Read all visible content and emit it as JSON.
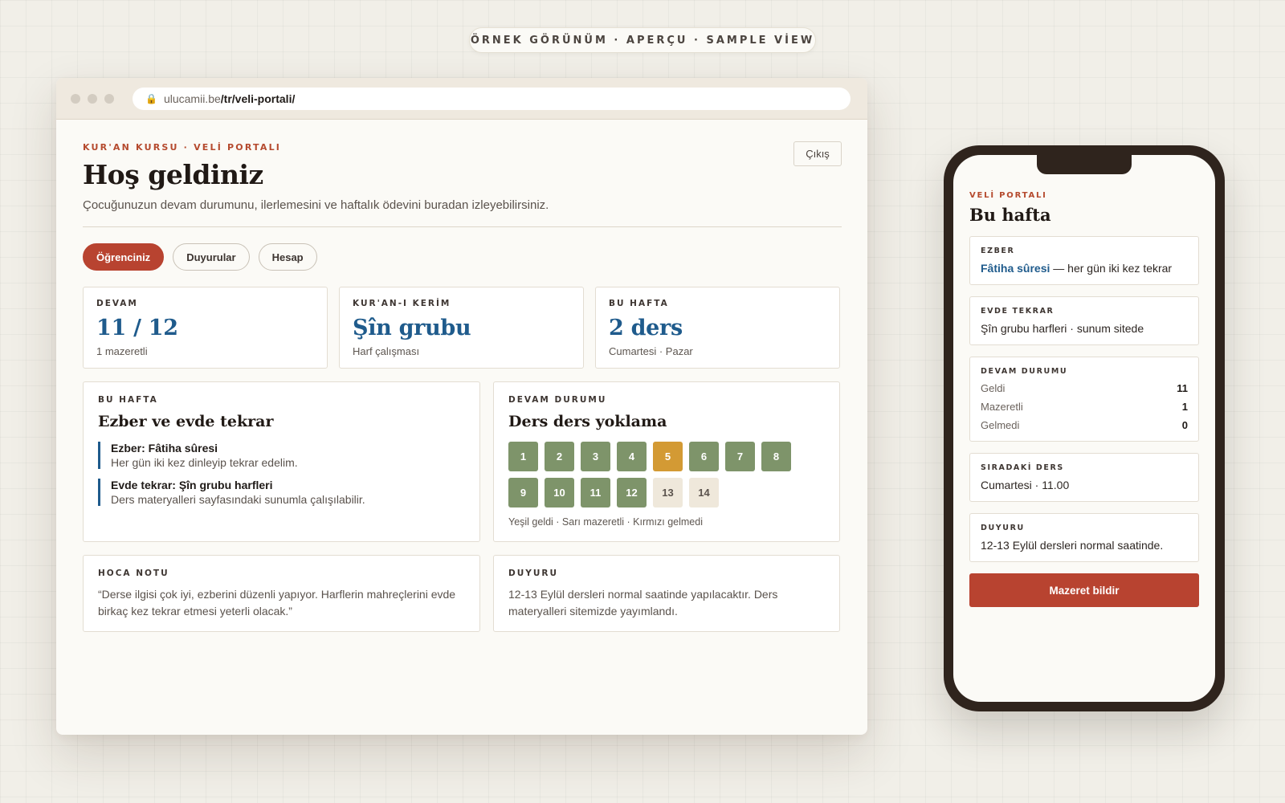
{
  "caption": "ÖRNEK GÖRÜNÜM · APERÇU · SAMPLE VİEW",
  "browser": {
    "url_domain": "ulucamii.be",
    "url_path": "/tr/veli-portali/"
  },
  "page": {
    "eyebrow": "KUR'AN KURSU · VELİ PORTALI",
    "logout": "Çıkış",
    "title": "Hoş geldiniz",
    "subtitle": "Çocuğunuzun devam durumunu, ilerlemesini ve haftalık ödevini buradan izleyebilirsiniz.",
    "tabs": [
      {
        "label": "Öğrenciniz",
        "active": true
      },
      {
        "label": "Duyurular",
        "active": false
      },
      {
        "label": "Hesap",
        "active": false
      }
    ],
    "stats": [
      {
        "label": "DEVAM",
        "value": "11 / 12",
        "note": "1 mazeretli"
      },
      {
        "label": "KUR'AN-I KERİM",
        "value": "Şîn grubu",
        "note": "Harf çalışması"
      },
      {
        "label": "BU HAFTA",
        "value": "2 ders",
        "note": "Cumartesi · Pazar"
      }
    ],
    "homework": {
      "label": "BU HAFTA",
      "title": "Ezber ve evde tekrar",
      "items": [
        {
          "heading": "Ezber: Fâtiha sûresi",
          "text": "Her gün iki kez dinleyip tekrar edelim."
        },
        {
          "heading": "Evde tekrar: Şîn grubu harfleri",
          "text": "Ders materyalleri sayfasındaki sunumla çalışılabilir."
        }
      ]
    },
    "attendance": {
      "label": "DEVAM DURUMU",
      "title": "Ders ders yoklama",
      "lessons": [
        {
          "n": "1",
          "status": "g"
        },
        {
          "n": "2",
          "status": "g"
        },
        {
          "n": "3",
          "status": "g"
        },
        {
          "n": "4",
          "status": "g"
        },
        {
          "n": "5",
          "status": "y"
        },
        {
          "n": "6",
          "status": "g"
        },
        {
          "n": "7",
          "status": "g"
        },
        {
          "n": "8",
          "status": "g"
        },
        {
          "n": "9",
          "status": "g"
        },
        {
          "n": "10",
          "status": "g"
        },
        {
          "n": "11",
          "status": "g"
        },
        {
          "n": "12",
          "status": "g"
        },
        {
          "n": "13",
          "status": "e"
        },
        {
          "n": "14",
          "status": "e"
        }
      ],
      "legend": "Yeşil geldi · Sarı mazeretli · Kırmızı gelmedi"
    },
    "teacher_note": {
      "label": "HOCA NOTU",
      "text": "“Derse ilgisi çok iyi, ezberini düzenli yapıyor. Harflerin mahreçlerini evde birkaç kez tekrar etmesi yeterli olacak.”"
    },
    "announcement": {
      "label": "DUYURU",
      "text": "12-13 Eylül dersleri normal saatinde yapılacaktır. Ders materyalleri sitemizde yayımlandı."
    }
  },
  "phone": {
    "eyebrow": "VELİ PORTALI",
    "title": "Bu hafta",
    "memorize": {
      "label": "EZBER",
      "link": "Fâtiha sûresi",
      "rest": " — her gün iki kez tekrar"
    },
    "home_review": {
      "label": "EVDE TEKRAR",
      "text": "Şîn grubu harfleri · sunum sitede"
    },
    "attendance": {
      "label": "DEVAM DURUMU",
      "rows": [
        {
          "k": "Geldi",
          "v": "11"
        },
        {
          "k": "Mazeretli",
          "v": "1"
        },
        {
          "k": "Gelmedi",
          "v": "0"
        }
      ]
    },
    "next_lesson": {
      "label": "SIRADAKİ DERS",
      "text": "Cumartesi · 11.00"
    },
    "announcement": {
      "label": "DUYURU",
      "text": "12-13 Eylül dersleri normal saatinde."
    },
    "button": "Mazeret bildir"
  },
  "colors": {
    "accent": "#b84330",
    "link": "#1f5b8c",
    "present": "#7e946a",
    "excused": "#d39a34",
    "upcoming": "#efe8db"
  }
}
